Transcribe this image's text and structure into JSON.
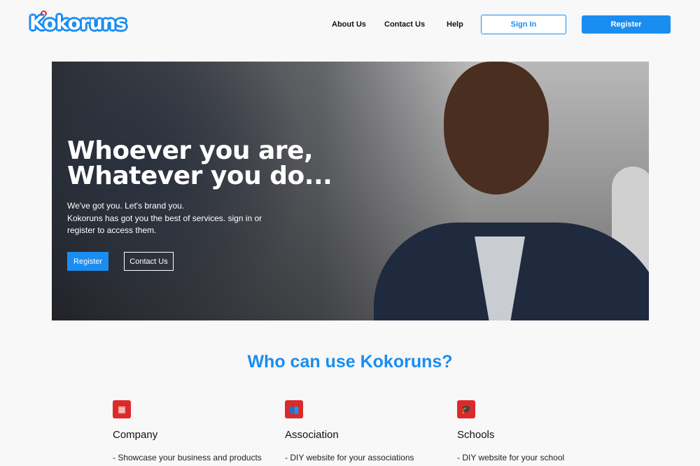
{
  "header": {
    "logo": "Kokoruns",
    "nav": [
      "About Us",
      "Contact Us",
      "Help"
    ],
    "sign_in": "Sign In",
    "register": "Register"
  },
  "hero": {
    "title_line1": "Whoever you are,",
    "title_line2": "Whatever you do...",
    "text_line1": "We've got you. Let's brand you.",
    "text_line2": "Kokoruns has got you the best of services. sign in or register to access them.",
    "register": "Register",
    "contact": "Contact Us"
  },
  "section": {
    "title": "Who can use Kokoruns?"
  },
  "cards": [
    {
      "icon": "building-icon",
      "title": "Company",
      "item": "- Showcase your business and products"
    },
    {
      "icon": "users-icon",
      "title": "Association",
      "item": "- DIY website for your associations"
    },
    {
      "icon": "graduation-cap-icon",
      "title": "Schools",
      "item": "- DIY website for your school"
    }
  ],
  "colors": {
    "accent": "#1a8df0",
    "icon_bg": "#dc2a2a"
  }
}
